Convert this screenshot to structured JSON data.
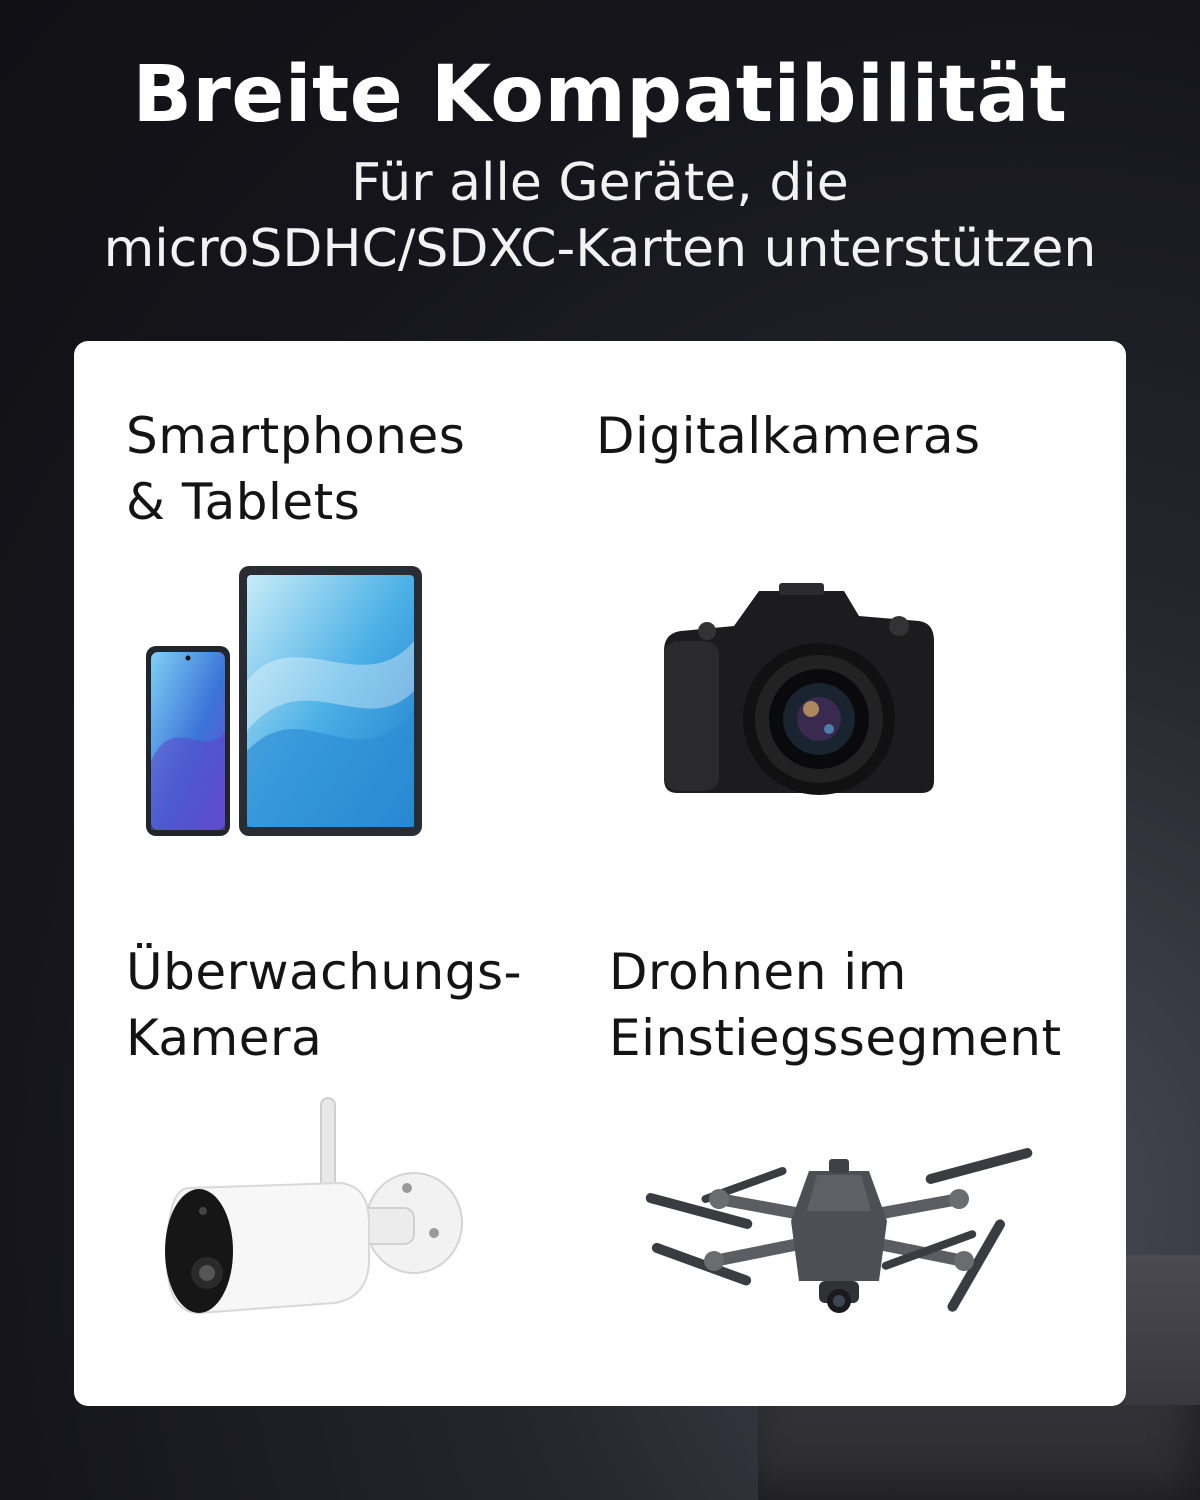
{
  "header": {
    "title": "Breite Kompatibilität",
    "subtitle_line1": "Für alle Geräte, die",
    "subtitle_line2": "microSDHC/SDXC-Karten unterstützen"
  },
  "devices": [
    {
      "line1": "Smartphones",
      "line2": "& Tablets",
      "icon": "smartphone-tablet-icon"
    },
    {
      "line1": "Digitalkameras",
      "line2": "",
      "icon": "camera-icon"
    },
    {
      "line1": "Überwachungs-",
      "line2": "Kamera",
      "icon": "security-camera-icon"
    },
    {
      "line1": "Drohnen im",
      "line2": "Einstiegssegment",
      "icon": "drone-icon"
    }
  ],
  "colors": {
    "background": "#15151b",
    "card": "#ffffff",
    "text_dark": "#141414",
    "text_light": "#ffffff"
  }
}
